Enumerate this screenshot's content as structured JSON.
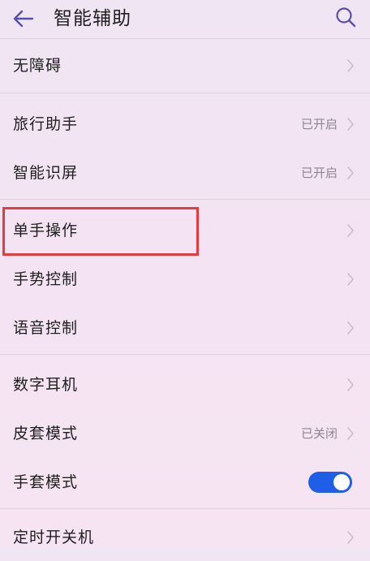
{
  "header": {
    "title": "智能辅助",
    "back_icon": "arrow-left-icon",
    "search_icon": "search-icon"
  },
  "settings": [
    {
      "label": "无障碍",
      "status": ""
    },
    {
      "label": "旅行助手",
      "status": "已开启"
    },
    {
      "label": "智能识屏",
      "status": "已开启"
    },
    {
      "label": "单手操作",
      "status": ""
    },
    {
      "label": "手势控制",
      "status": ""
    },
    {
      "label": "语音控制",
      "status": ""
    },
    {
      "label": "数字耳机",
      "status": ""
    },
    {
      "label": "皮套模式",
      "status": "已关闭"
    },
    {
      "label": "手套模式",
      "toggle_on": true
    },
    {
      "label": "定时开关机",
      "status": ""
    }
  ],
  "colors": {
    "accent": "#1f5ee6",
    "highlight_box": "#e53b40"
  }
}
